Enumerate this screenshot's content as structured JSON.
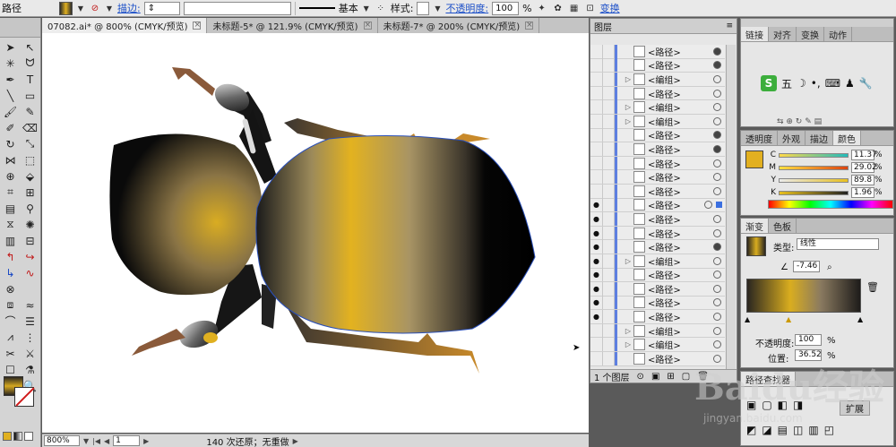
{
  "control_bar": {
    "object_type": "路径",
    "stroke_label": "描边:",
    "stroke_style": "基本",
    "style_label": "样式:",
    "opacity_label": "不透明度:",
    "opacity_value": "100",
    "opacity_unit": "%",
    "transform_label": "变换"
  },
  "tabs": [
    {
      "label": "07082.ai* @ 800% (CMYK/预览)"
    },
    {
      "label": "未标题-5* @ 121.9% (CMYK/预览)"
    },
    {
      "label": "未标题-7* @ 200% (CMYK/预览)"
    }
  ],
  "status": {
    "zoom": "800%",
    "page": "1",
    "history": "140 次还原；无重做"
  },
  "layers": {
    "title": "图层",
    "footer": "1 个图层",
    "rows": [
      {
        "name": "<路径>",
        "vis": false,
        "expand": false,
        "target": "filled"
      },
      {
        "name": "<路径>",
        "vis": false,
        "expand": false,
        "target": "filled"
      },
      {
        "name": "<编组>",
        "vis": false,
        "expand": true,
        "target": "empty"
      },
      {
        "name": "<路径>",
        "vis": false,
        "expand": false,
        "target": "empty"
      },
      {
        "name": "<编组>",
        "vis": false,
        "expand": true,
        "target": "empty"
      },
      {
        "name": "<编组>",
        "vis": false,
        "expand": true,
        "target": "empty"
      },
      {
        "name": "<路径>",
        "vis": false,
        "expand": false,
        "target": "filled"
      },
      {
        "name": "<路径>",
        "vis": false,
        "expand": false,
        "target": "filled"
      },
      {
        "name": "<路径>",
        "vis": false,
        "expand": false,
        "target": "empty"
      },
      {
        "name": "<路径>",
        "vis": false,
        "expand": false,
        "target": "empty"
      },
      {
        "name": "<路径>",
        "vis": false,
        "expand": false,
        "target": "empty"
      },
      {
        "name": "<路径>",
        "vis": true,
        "expand": false,
        "target": "selected"
      },
      {
        "name": "<路径>",
        "vis": true,
        "expand": false,
        "target": "empty"
      },
      {
        "name": "<路径>",
        "vis": true,
        "expand": false,
        "target": "empty"
      },
      {
        "name": "<路径>",
        "vis": true,
        "expand": false,
        "target": "filled"
      },
      {
        "name": "<编组>",
        "vis": true,
        "expand": true,
        "target": "empty"
      },
      {
        "name": "<路径>",
        "vis": true,
        "expand": false,
        "target": "empty"
      },
      {
        "name": "<路径>",
        "vis": true,
        "expand": false,
        "target": "empty"
      },
      {
        "name": "<路径>",
        "vis": true,
        "expand": false,
        "target": "empty"
      },
      {
        "name": "<路径>",
        "vis": true,
        "expand": false,
        "target": "empty"
      },
      {
        "name": "<编组>",
        "vis": false,
        "expand": true,
        "target": "empty"
      },
      {
        "name": "<编组>",
        "vis": false,
        "expand": true,
        "target": "empty"
      },
      {
        "name": "<路径>",
        "vis": false,
        "expand": false,
        "target": "empty"
      }
    ]
  },
  "panel_top": {
    "tabs": [
      "链接",
      "对齐",
      "变换",
      "动作"
    ],
    "ime_label": "五"
  },
  "color_panel": {
    "tabs": [
      "透明度",
      "外观",
      "描边",
      "颜色"
    ],
    "channels": [
      {
        "label": "C",
        "value": "11.37"
      },
      {
        "label": "M",
        "value": "29.02"
      },
      {
        "label": "Y",
        "value": "89.8"
      },
      {
        "label": "K",
        "value": "1.96"
      }
    ],
    "unit": "%"
  },
  "gradient_panel": {
    "tabs": [
      "渐变",
      "色板"
    ],
    "type_label": "类型:",
    "type_value": "线性",
    "angle_value": "-7.46",
    "opacity_label": "不透明度:",
    "opacity_value": "100",
    "position_label": "位置:",
    "position_value": "36.52",
    "unit": "%"
  },
  "bottom_panel": {
    "tab_left": "路径查找器",
    "expand_label": "扩展"
  },
  "watermark": {
    "text": "Baidu经验",
    "sub": "jingyan.baidu.com"
  },
  "colors": {
    "accent": "#1d50c8",
    "gold": "#e2b020",
    "layer_bar": "#5d7fe0"
  }
}
